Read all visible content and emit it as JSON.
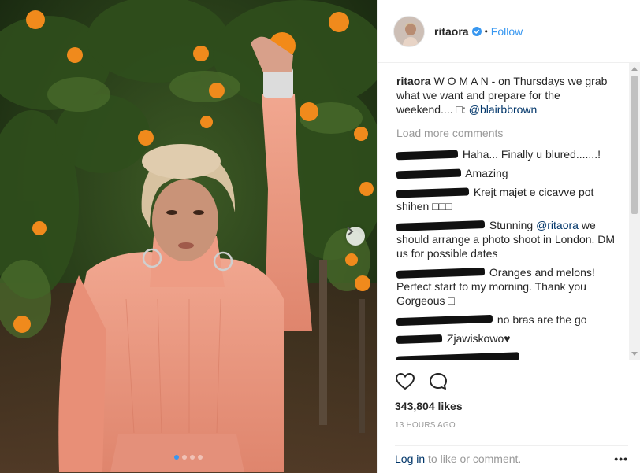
{
  "photo": {
    "carousel_dots": 4,
    "active_dot": 0
  },
  "header": {
    "username": "ritaora",
    "separator": "•",
    "follow_label": "Follow"
  },
  "caption": {
    "username": "ritaora",
    "text": "W O M A N - on Thursdays we grab what we want and prepare for the weekend.... □: ",
    "mention": "@blairbbrown"
  },
  "load_more_label": "Load more comments",
  "comments": [
    {
      "text": "Haha... Finally u blured.......!"
    },
    {
      "text": "Amazing"
    },
    {
      "text": "Krejt majet e cicavve pot shihen □□□"
    },
    {
      "text": "Stunning ",
      "mention": "@ritaora",
      "text2": " we should arrange a photo shoot in London. DM us for possible dates"
    },
    {
      "text": "Oranges and melons! Perfect start to my morning. Thank you Gorgeous □"
    },
    {
      "text": "no bras are the go"
    },
    {
      "text": "Zjawiskowo♥"
    },
    {
      "text": ""
    }
  ],
  "likes": "343,804 likes",
  "timestamp": "13 HOURS AGO",
  "login": {
    "link": "Log in",
    "rest": " to like or comment.",
    "more": "•••"
  },
  "icons": {
    "like": "heart-icon",
    "comment": "comment-icon",
    "verified": "verified-badge-icon",
    "next": "chevron-right-icon"
  },
  "colors": {
    "accent": "#3897f0",
    "text": "#262626",
    "muted": "#999999",
    "mention": "#003569",
    "blouse": "#e8917a"
  }
}
